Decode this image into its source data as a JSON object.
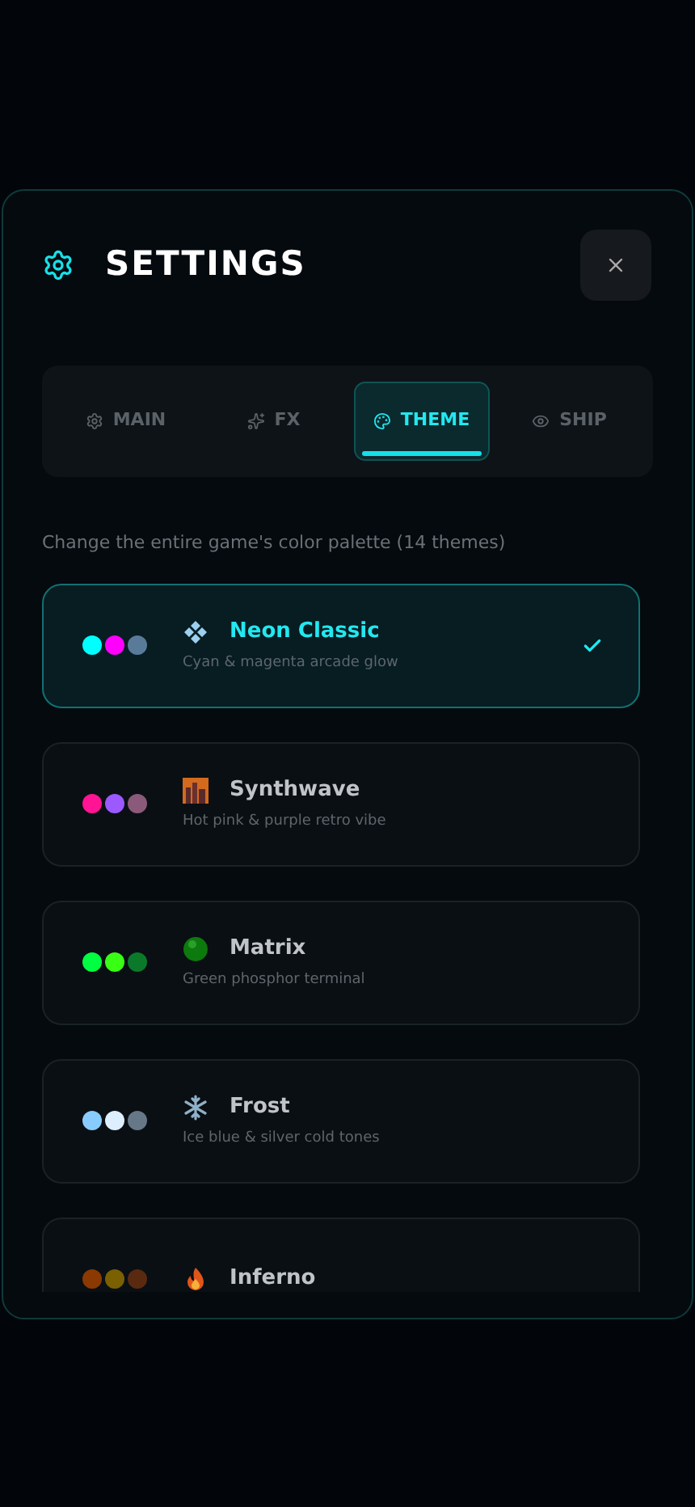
{
  "title": "SETTINGS",
  "tabs": [
    {
      "label": "MAIN",
      "kind": "gear",
      "selected": false
    },
    {
      "label": "FX",
      "kind": "sparkle",
      "selected": false
    },
    {
      "label": "THEME",
      "kind": "palette",
      "selected": true
    },
    {
      "label": "SHIP",
      "kind": "eye",
      "selected": false
    }
  ],
  "description": "Change the entire game's color palette (14 themes)",
  "themes": [
    {
      "name": "Neon Classic",
      "subtitle": "Cyan & magenta arcade glow",
      "kind": "diamonds",
      "selected": true,
      "swatches": [
        {
          "color": "#00ffff"
        },
        {
          "color": "#ff00ff"
        },
        {
          "color": "#5a7a9a"
        }
      ]
    },
    {
      "name": "Synthwave",
      "subtitle": "Hot pink & purple retro vibe",
      "kind": "city",
      "selected": false,
      "swatches": [
        {
          "color": "#ff1493"
        },
        {
          "color": "#9b59ff"
        },
        {
          "color": "#8b5a7a"
        }
      ]
    },
    {
      "name": "Matrix",
      "subtitle": "Green phosphor terminal",
      "kind": "ball",
      "selected": false,
      "swatches": [
        {
          "color": "#00ff41"
        },
        {
          "color": "#39ff14"
        },
        {
          "color": "#0a7a2a"
        }
      ]
    },
    {
      "name": "Frost",
      "subtitle": "Ice blue & silver cold tones",
      "kind": "snowflake",
      "selected": false,
      "swatches": [
        {
          "color": "#88ccff"
        },
        {
          "color": "#ddeeff"
        },
        {
          "color": "#667788"
        }
      ]
    },
    {
      "name": "Inferno",
      "kind": "flame",
      "selected": false,
      "swatches": [
        {
          "color": "#8a3a00"
        },
        {
          "color": "#7a6000"
        },
        {
          "color": "#5a2a10"
        }
      ]
    }
  ]
}
